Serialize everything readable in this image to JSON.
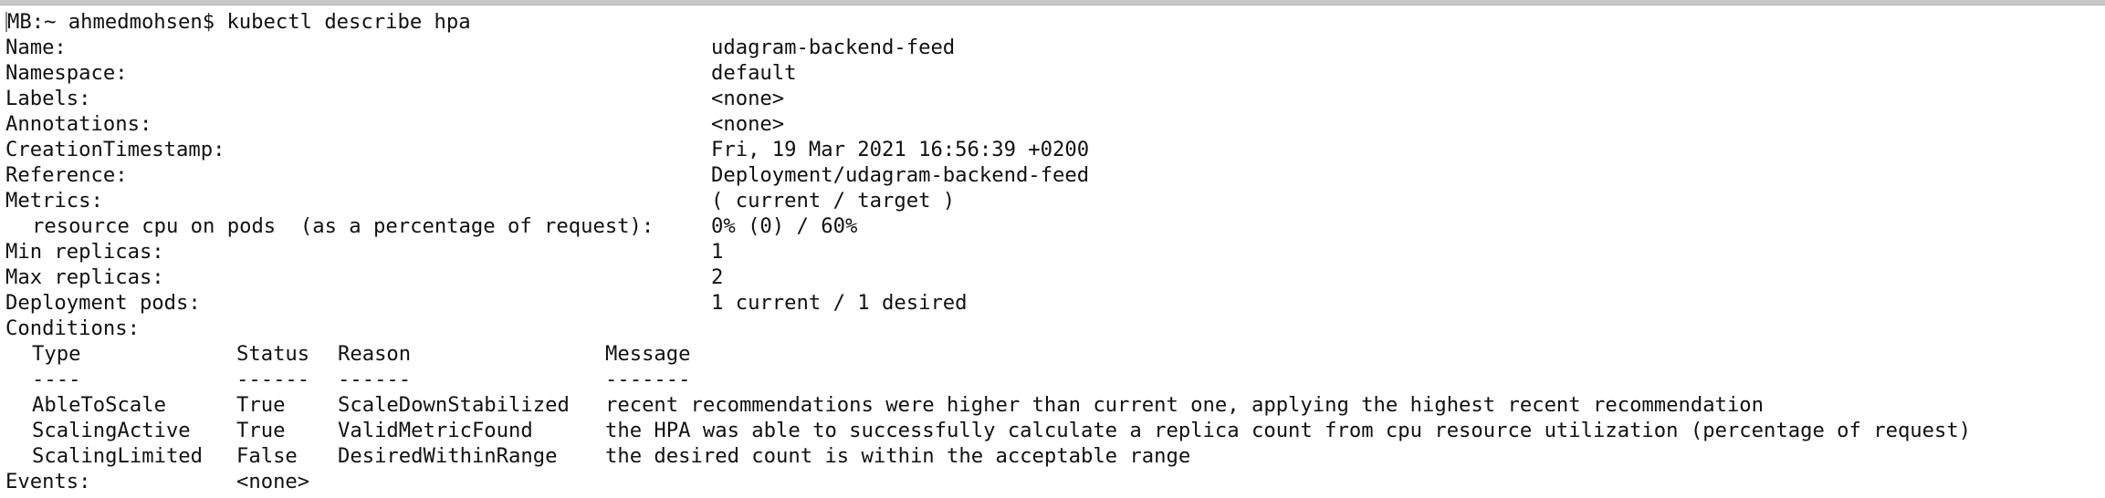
{
  "prompt": {
    "host_prefix": "MB:~",
    "user": "ahmedmohsen$",
    "command": "kubectl describe hpa"
  },
  "fields": [
    {
      "key": "Name:",
      "value": "udagram-backend-feed"
    },
    {
      "key": "Namespace:",
      "value": "default"
    },
    {
      "key": "Labels:",
      "value": "<none>"
    },
    {
      "key": "Annotations:",
      "value": "<none>"
    },
    {
      "key": "CreationTimestamp:",
      "value": "Fri, 19 Mar 2021 16:56:39 +0200"
    },
    {
      "key": "Reference:",
      "value": "Deployment/udagram-backend-feed"
    },
    {
      "key": "Metrics:",
      "value": "( current / target )"
    },
    {
      "key": "resource cpu on pods  (as a percentage of request):",
      "value": "0% (0) / 60%"
    },
    {
      "key": "Min replicas:",
      "value": "1"
    },
    {
      "key": "Max replicas:",
      "value": "2"
    },
    {
      "key": "Deployment pods:",
      "value": "1 current / 1 desired"
    }
  ],
  "conditions": {
    "label": "Conditions:",
    "headers": [
      "Type",
      "Status",
      "Reason",
      "Message"
    ],
    "underlines": [
      "----",
      "------",
      "------",
      "-------"
    ],
    "rows": [
      [
        "AbleToScale",
        "True",
        "ScaleDownStabilized",
        "recent recommendations were higher than current one, applying the highest recent recommendation"
      ],
      [
        "ScalingActive",
        "True",
        "ValidMetricFound",
        "the HPA was able to successfully calculate a replica count from cpu resource utilization (percentage of request)"
      ],
      [
        "ScalingLimited",
        "False",
        "DesiredWithinRange",
        "the desired count is within the acceptable range"
      ]
    ]
  },
  "events": {
    "label": "Events:",
    "value": "<none>"
  }
}
